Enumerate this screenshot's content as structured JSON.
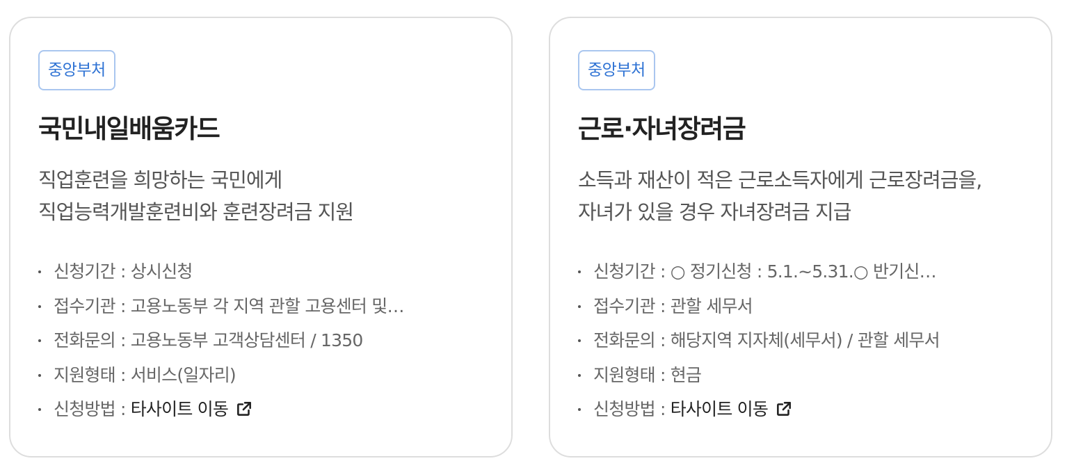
{
  "cards": [
    {
      "tag": "중앙부처",
      "title": "국민내일배움카드",
      "desc_lines": [
        "직업훈련을 희망하는 국민에게",
        "직업능력개발훈련비와 훈련장려금 지원"
      ],
      "info": [
        {
          "label": "신청기간",
          "sep": " : ",
          "value": "상시신청"
        },
        {
          "label": "접수기관",
          "sep": " : ",
          "value": "고용노동부 각 지역 관할 고용센터 및…"
        },
        {
          "label": "전화문의",
          "sep": " : ",
          "value": "고용노동부 고객상담센터 / 1350"
        },
        {
          "label": "지원형태",
          "sep": " : ",
          "value": "서비스(일자리)"
        },
        {
          "label": "신청방법",
          "sep": " : ",
          "value": "타사이트 이동",
          "icon": "external-link-icon"
        }
      ]
    },
    {
      "tag": "중앙부처",
      "title": "근로·자녀장려금",
      "desc_lines": [
        "소득과 재산이 적은 근로소득자에게 근로장려금을,",
        "자녀가 있을 경우 자녀장려금 지급"
      ],
      "info": [
        {
          "label": "신청기간",
          "sep": " : ",
          "value": "○ 정기신청 : 5.1.~5.31.○ 반기신…"
        },
        {
          "label": "접수기관",
          "sep": " : ",
          "value": "관할 세무서"
        },
        {
          "label": "전화문의",
          "sep": " : ",
          "value": "해당지역 지자체(세무서) / 관할 세무서"
        },
        {
          "label": "지원형태",
          "sep": " : ",
          "value": "현금"
        },
        {
          "label": "신청방법",
          "sep": " : ",
          "value": "타사이트 이동",
          "icon": "external-link-icon"
        }
      ]
    }
  ],
  "colors": {
    "tag_text": "#2f73d4",
    "tag_border": "#a9c6ef",
    "card_border": "#dddddd",
    "title": "#222222"
  }
}
